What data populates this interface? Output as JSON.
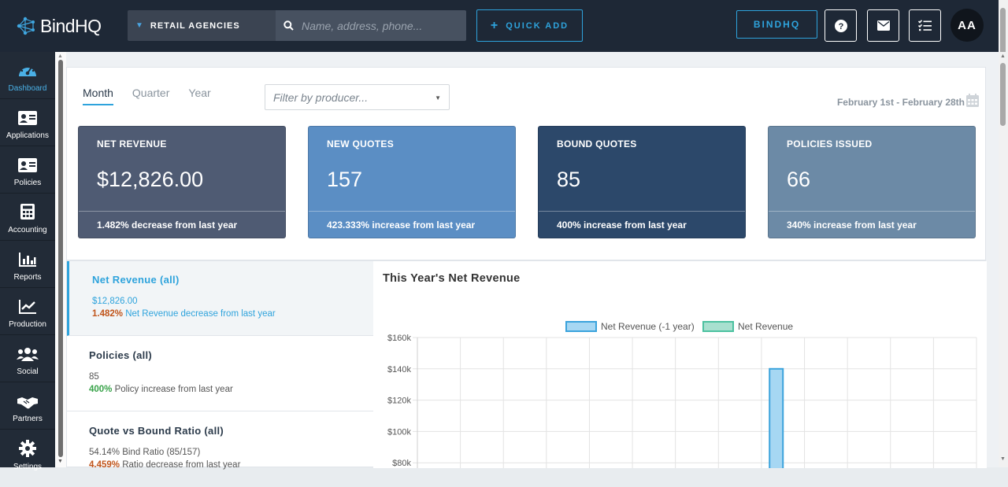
{
  "brand": {
    "name": "BindHQ"
  },
  "header": {
    "agency_label": "RETAIL AGENCIES",
    "search_placeholder": "Name, address, phone...",
    "quick_add_label": "QUICK ADD",
    "bindhq_label": "BINDHQ",
    "avatar_initials": "AA"
  },
  "sidebar": {
    "items": [
      {
        "label": "Dashboard",
        "icon": "dashboard-gauge-icon"
      },
      {
        "label": "Applications",
        "icon": "applications-card-icon"
      },
      {
        "label": "Policies",
        "icon": "policies-card-icon"
      },
      {
        "label": "Accounting",
        "icon": "calculator-icon"
      },
      {
        "label": "Reports",
        "icon": "bar-chart-icon"
      },
      {
        "label": "Production",
        "icon": "line-chart-icon"
      },
      {
        "label": "Social",
        "icon": "users-icon"
      },
      {
        "label": "Partners",
        "icon": "handshake-icon"
      },
      {
        "label": "Settings",
        "icon": "gear-icon"
      }
    ]
  },
  "period_tabs": [
    "Month",
    "Quarter",
    "Year"
  ],
  "producer_filter": {
    "placeholder": "Filter by producer..."
  },
  "date_range": "February 1st - February 28th",
  "cards": [
    {
      "label": "NET REVENUE",
      "value": "$12,826.00",
      "footer": "1.482% decrease from last year"
    },
    {
      "label": "NEW QUOTES",
      "value": "157",
      "footer": "423.333% increase from last year"
    },
    {
      "label": "BOUND QUOTES",
      "value": "85",
      "footer": "400% increase from last year"
    },
    {
      "label": "POLICIES ISSUED",
      "value": "66",
      "footer": "340% increase from last year"
    }
  ],
  "metrics": [
    {
      "title": "Net Revenue (all)",
      "value": "$12,826.00",
      "pct": "1.482%",
      "desc": " Net Revenue decrease from last year"
    },
    {
      "title": "Policies (all)",
      "value": "85",
      "pct": "400%",
      "desc": " Policy increase from last year"
    },
    {
      "title": "Quote vs Bound Ratio (all)",
      "value": "54.14% Bind Ratio (85/157)",
      "pct": "4.459%",
      "desc": " Ratio decrease from last year"
    }
  ],
  "chart_title": "This Year's Net Revenue",
  "colors": {
    "accent": "#2ea3dc",
    "prev_year_fill": "#a6d7f3",
    "prev_year_stroke": "#3ba3dc",
    "curr_fill": "#a8e0cf",
    "curr_stroke": "#4cc1a0"
  },
  "chart_data": {
    "type": "bar",
    "title": "This Year's Net Revenue",
    "legend": [
      "Net Revenue (-1 year)",
      "Net Revenue"
    ],
    "legend_position": "top",
    "ytick_labels": [
      "$160k",
      "$140k",
      "$120k",
      "$100k",
      "$80k"
    ],
    "ylim": [
      0,
      160000
    ],
    "grid": true,
    "category_count": 13,
    "series": [
      {
        "name": "Net Revenue (-1 year)",
        "values": [
          null,
          null,
          null,
          null,
          null,
          null,
          null,
          null,
          140000,
          null,
          null,
          null,
          null
        ]
      },
      {
        "name": "Net Revenue",
        "values": [
          null,
          null,
          null,
          null,
          null,
          null,
          null,
          null,
          null,
          null,
          null,
          null,
          null
        ]
      }
    ]
  }
}
